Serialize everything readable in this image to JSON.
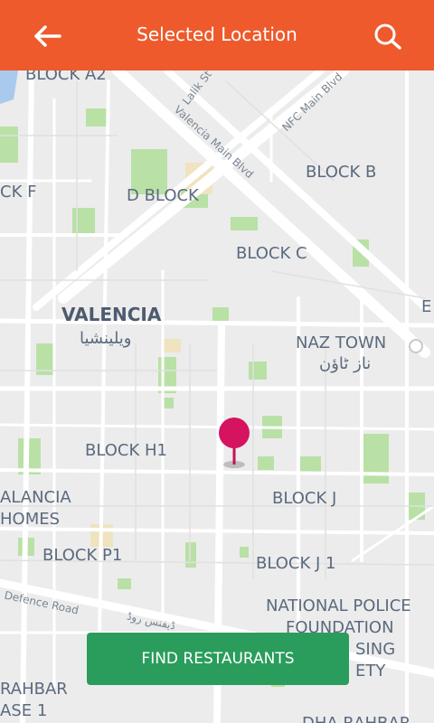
{
  "header": {
    "title": "Selected Location",
    "back_icon": "arrow-left-icon",
    "search_icon": "search-icon",
    "color": "#ee5a2c"
  },
  "map": {
    "labels": {
      "block_a2": "BLOCK A2",
      "lalik_st": "Lalik St",
      "valencia_main_blvd": "Valencia Main Blvd",
      "nfc_main_blvd": "NFC Main Blvd",
      "block_b": "BLOCK B",
      "ck_f": "CK F",
      "d_block": "D BLOCK",
      "block_c": "BLOCK C",
      "valencia": "VALENCIA",
      "valencia_urdu": "ویلینشیا",
      "e_edge": "E",
      "naz_town": "NAZ TOWN",
      "naz_town_urdu": "ناز ٹاؤن",
      "block_h1": "BLOCK H1",
      "block_j": "BLOCK J",
      "alancia": "ALANCIA",
      "homes": "HOMES",
      "block_p1": "BLOCK P1",
      "block_j1": "BLOCK J 1",
      "defence_road": "Defence Road",
      "defence_road_urdu": "ڈیفنس روڈ",
      "national_police_1": "NATIONAL POLICE",
      "national_police_2": "FOUNDATION",
      "national_police_3": "SING",
      "national_police_4": "ETY",
      "rahbar_1": "RAHBAR",
      "rahbar_2": "ASE 1",
      "dha_rahbar": "DHA RAHBAR"
    },
    "pin_color": "#d5135e",
    "park_color": "#b9e1a6"
  },
  "cta": {
    "label": "FIND RESTAURANTS",
    "color": "#2a9d5c"
  }
}
